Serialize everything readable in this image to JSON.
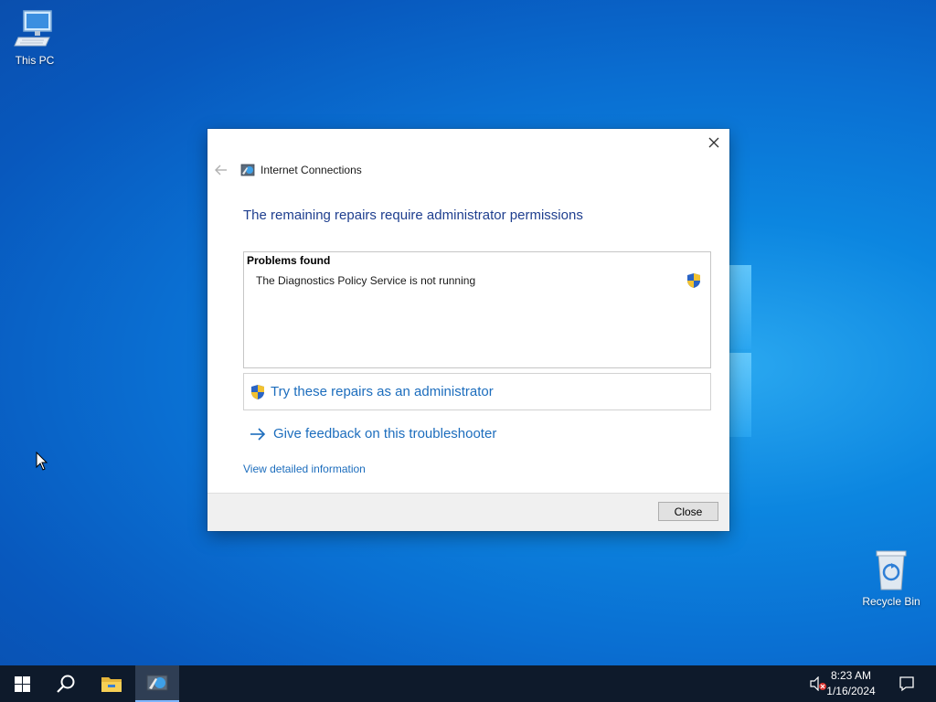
{
  "desktop": {
    "icons": [
      {
        "label": "This PC",
        "icon": "computer-icon"
      },
      {
        "label": "Recycle Bin",
        "icon": "recycle-bin-icon"
      }
    ]
  },
  "dialog": {
    "app_title": "Internet Connections",
    "heading": "The remaining repairs require administrator permissions",
    "problems": {
      "title": "Problems found",
      "items": [
        "The Diagnostics Policy Service is not running"
      ]
    },
    "admin_repair_label": "Try these repairs as an administrator",
    "feedback_label": "Give feedback on this troubleshooter",
    "detail_link": "View detailed information",
    "close_button": "Close"
  },
  "taskbar": {
    "clock_time": "8:23 AM",
    "clock_date": "1/16/2024",
    "items": [
      "start-icon",
      "search-icon",
      "file-explorer-icon",
      "troubleshooter-icon"
    ],
    "tray": [
      "volume-muted-icon",
      "notifications-icon"
    ]
  },
  "colors": {
    "link": "#1c6dbd",
    "heading": "#1f3f8f",
    "taskbar": "#0e1a2b"
  }
}
